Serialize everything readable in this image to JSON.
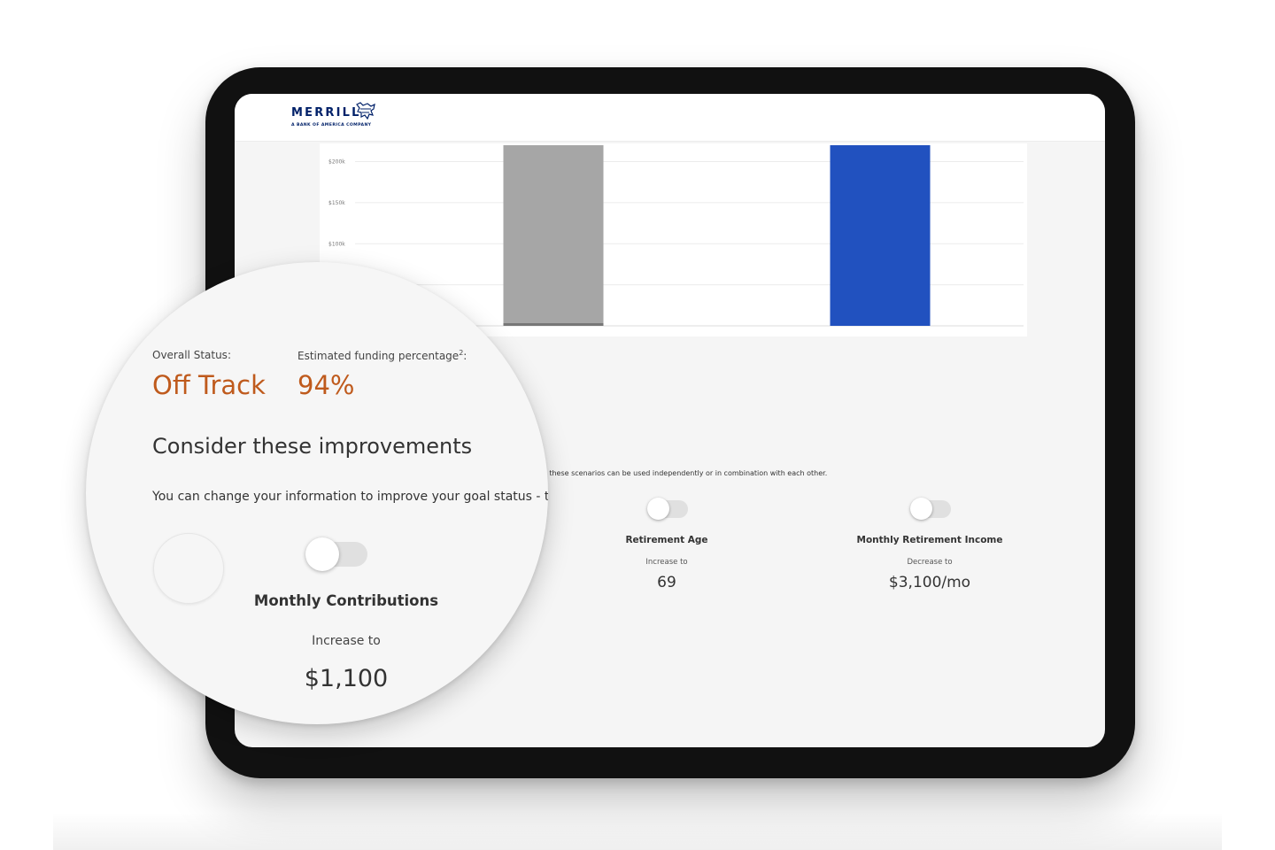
{
  "brand": {
    "name": "MERRILL",
    "tagline": "A BANK OF AMERICA COMPANY",
    "color": "#012169"
  },
  "chart_data": {
    "type": "bar",
    "categories": [
      "",
      ""
    ],
    "values": [
      220000,
      220000
    ],
    "colors": [
      "#a6a6a6",
      "#2151bf"
    ],
    "y_tick_labels": [
      "$200k",
      "$150k",
      "$100k"
    ],
    "y_ticks": [
      200000,
      150000,
      100000
    ],
    "ylim": [
      0,
      220000
    ],
    "grid": true
  },
  "status": {
    "overall_label": "Overall Status:",
    "overall_value": "Off Track",
    "funding_label": "Estimated funding percentage",
    "funding_sup": "2",
    "funding_suffix": ":",
    "funding_value": "94%",
    "value_color": "#bf5a1c"
  },
  "improvements": {
    "heading": "Consider these improvements",
    "description_magnified": "You can change your information to improve your goal status - t",
    "description_screen": "tus - these scenarios can be used independently or in combination with each other.",
    "options": [
      {
        "title": "Monthly Contributions",
        "change": "Increase to",
        "value": "$1,100",
        "enabled": false
      },
      {
        "title": "Retirement Age",
        "change": "Increase to",
        "value": "69",
        "enabled": false
      },
      {
        "title": "Monthly Retirement Income",
        "change": "Decrease to",
        "value": "$3,100/mo",
        "enabled": false
      }
    ]
  }
}
